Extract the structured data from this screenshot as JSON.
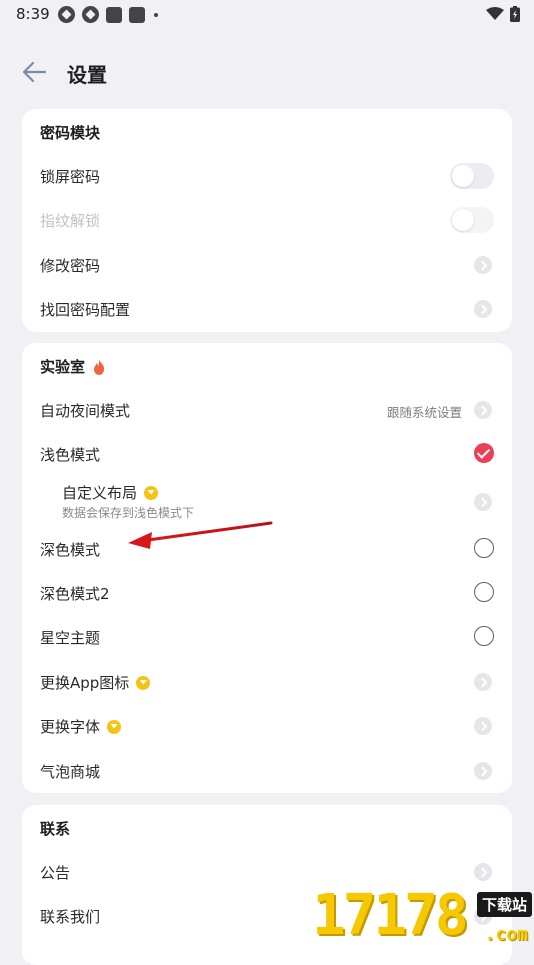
{
  "status_bar": {
    "time": "8:39"
  },
  "header": {
    "title": "设置"
  },
  "sections": {
    "password": {
      "title": "密码模块",
      "lock_screen": "锁屏密码",
      "fingerprint": "指纹解锁",
      "change_password": "修改密码",
      "recover_config": "找回密码配置"
    },
    "lab": {
      "title": "实验室",
      "auto_night": "自动夜间模式",
      "auto_night_value": "跟随系统设置",
      "light_mode": "浅色模式",
      "custom_layout": "自定义布局",
      "custom_layout_desc": "数据会保存到浅色模式下",
      "dark_mode": "深色模式",
      "dark_mode_2": "深色模式2",
      "starry_theme": "星空主题",
      "change_icon": "更换App图标",
      "change_font": "更换字体",
      "bubble_store": "气泡商城"
    },
    "contact": {
      "title": "联系",
      "announcement": "公告",
      "contact_us": "联系我们"
    }
  },
  "state": {
    "lock_screen_enabled": false,
    "fingerprint_enabled": false,
    "selected_theme": "浅色模式"
  },
  "watermark": {
    "digits": "17178",
    "tag": "下载站",
    "domain": ".com"
  },
  "colors": {
    "accent": "#ea3f57",
    "vip": "#f5c312",
    "background": "#f1f1f5",
    "card": "#ffffff"
  }
}
